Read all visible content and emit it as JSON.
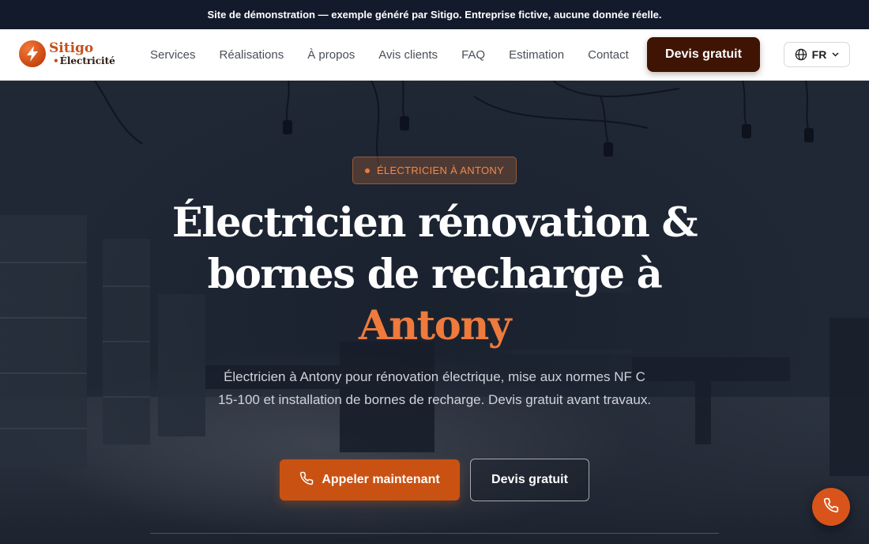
{
  "topbar": {
    "notice": "Site de démonstration — exemple généré par Sitigo. Entreprise fictive, aucune donnée réelle."
  },
  "header": {
    "logo_name": "Sitigo",
    "logo_sub": "Électricité",
    "nav": [
      "Services",
      "Réalisations",
      "À propos",
      "Avis clients",
      "FAQ",
      "Estimation",
      "Contact"
    ],
    "cta_label": "Devis gratuit",
    "lang_label": "FR"
  },
  "hero": {
    "badge": "ÉLECTRICIEN À ANTONY",
    "title_line1": "Électricien rénovation &",
    "title_line2": "bornes de recharge à",
    "title_accent": "Antony",
    "description": "Électricien à Antony pour rénovation électrique, mise aux normes NF C 15-100 et installation de bornes de recharge. Devis gratuit avant travaux.",
    "primary_button": "Appeler maintenant",
    "secondary_button": "Devis gratuit"
  },
  "colors": {
    "accent": "#ee7a3c",
    "primary_button": "#c95213",
    "cta_dark": "#3f1404",
    "topbar_bg": "#131a2b"
  },
  "icons": {
    "logo": "lightning-bolt-icon",
    "language": "globe-icon",
    "dropdown": "chevron-down-icon",
    "call": "phone-icon",
    "floating": "phone-icon"
  }
}
